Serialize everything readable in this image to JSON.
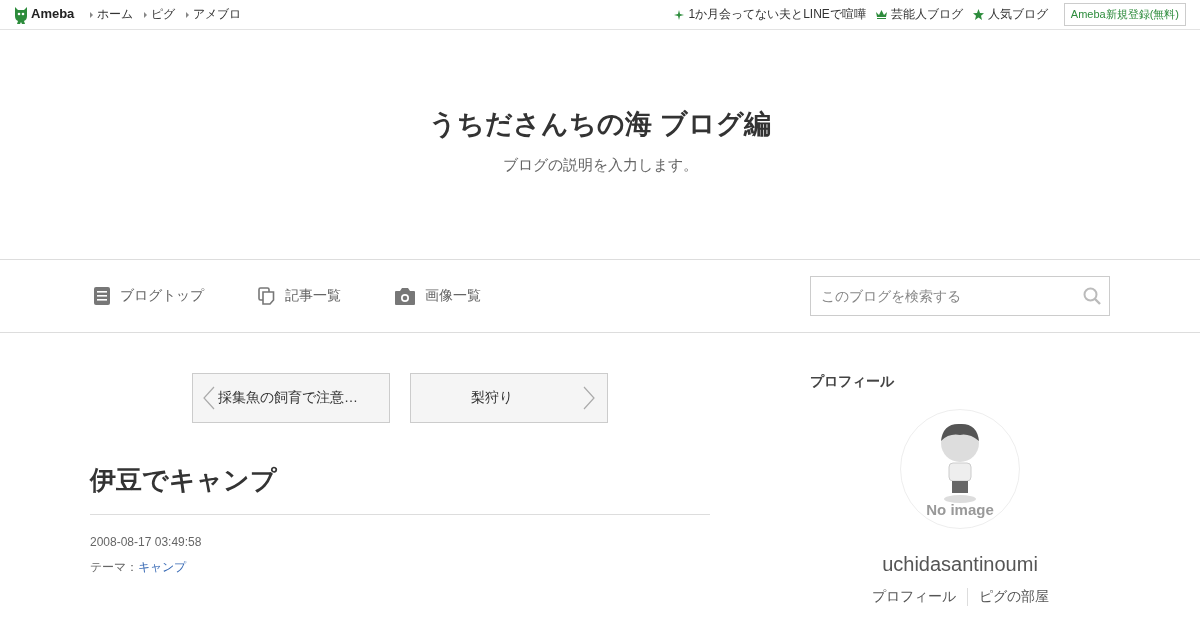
{
  "top_bar": {
    "logo": "Ameba",
    "links": [
      "ホーム",
      "ピグ",
      "アメブロ"
    ],
    "right_links": [
      {
        "kind": "sparkle",
        "label": "1か月会ってない夫とLINEで喧嘩"
      },
      {
        "kind": "crown",
        "label": "芸能人ブログ"
      },
      {
        "kind": "star",
        "label": "人気ブログ"
      }
    ],
    "register_button": "Ameba新規登録(無料)"
  },
  "header": {
    "title": "うちださんちの海 ブログ編",
    "description": "ブログの説明を入力します。"
  },
  "nav": {
    "items": [
      {
        "kind": "list",
        "label": "ブログトップ"
      },
      {
        "kind": "pages",
        "label": "記事一覧"
      },
      {
        "kind": "camera",
        "label": "画像一覧"
      }
    ],
    "search": {
      "placeholder": "このブログを検索する"
    }
  },
  "pager": {
    "previous": "採集魚の飼育で注意…",
    "next": "梨狩り"
  },
  "article": {
    "title": "伊豆でキャンプ",
    "date": "2008-08-17 03:49:58",
    "theme_label": "テーマ：",
    "theme": "キャンプ"
  },
  "sidebar": {
    "heading": "プロフィール",
    "avatar_caption": "No image",
    "name": "uchidasantinoumi",
    "links": [
      "プロフィール",
      "ピグの部屋"
    ]
  }
}
